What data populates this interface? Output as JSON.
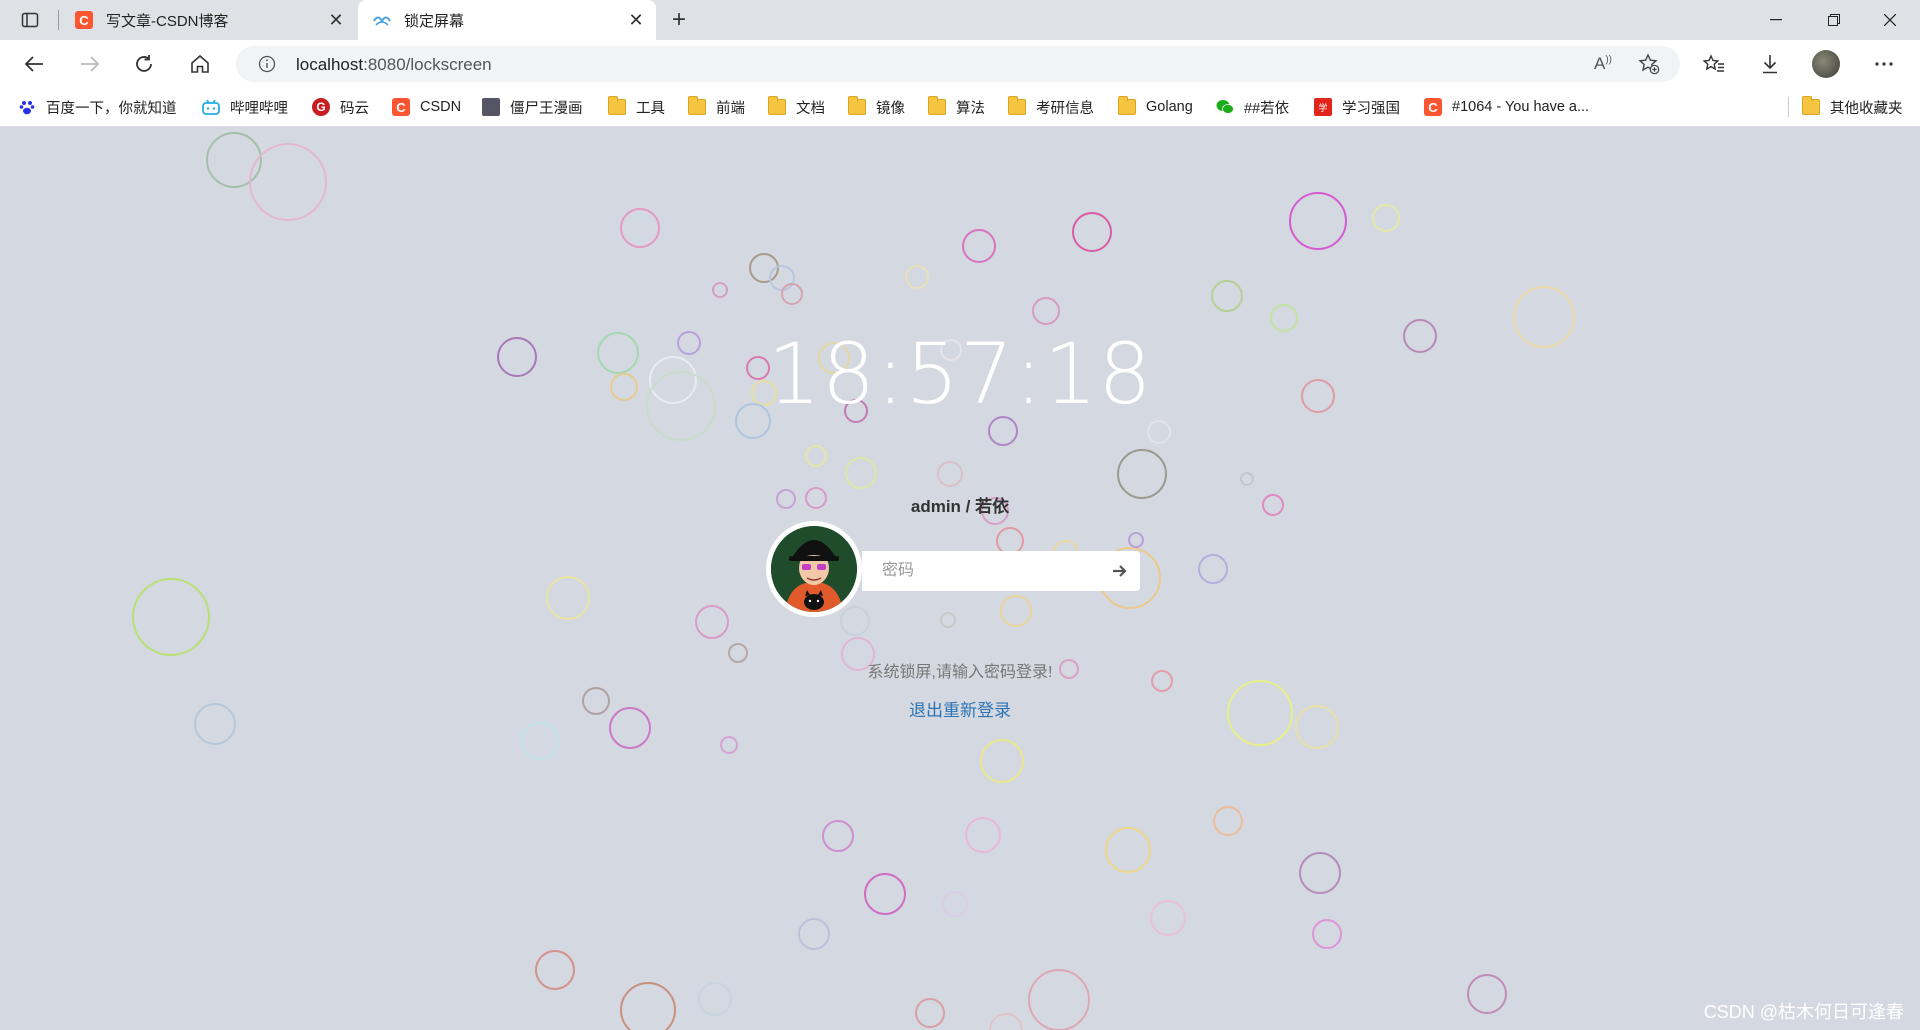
{
  "tabs": [
    {
      "title": "写文章-CSDN博客",
      "icon": "csdn-icon"
    },
    {
      "title": "锁定屏幕",
      "icon": "element-icon"
    }
  ],
  "address_bar": {
    "host": "localhost",
    "path": ":8080/lockscreen"
  },
  "bookmarks": [
    {
      "label": "百度一下，你就知道",
      "icon": "baidu-icon"
    },
    {
      "label": "哔哩哔哩",
      "icon": "bilibili-icon"
    },
    {
      "label": "码云",
      "icon": "gitee-icon"
    },
    {
      "label": "CSDN",
      "icon": "csdn-icon"
    },
    {
      "label": "僵尸王漫画",
      "icon": "manga-icon"
    },
    {
      "label": "工具",
      "icon": "folder-icon"
    },
    {
      "label": "前端",
      "icon": "folder-icon"
    },
    {
      "label": "文档",
      "icon": "folder-icon"
    },
    {
      "label": "镜像",
      "icon": "folder-icon"
    },
    {
      "label": "算法",
      "icon": "folder-icon"
    },
    {
      "label": "考研信息",
      "icon": "folder-icon"
    },
    {
      "label": "Golang",
      "icon": "folder-icon"
    },
    {
      "label": "##若依",
      "icon": "wechat-icon"
    },
    {
      "label": "学习强国",
      "icon": "xuexi-icon"
    },
    {
      "label": "#1064 - You have a...",
      "icon": "csdn-icon"
    }
  ],
  "other_bookmarks": "其他收藏夹",
  "lock": {
    "time": "18:57:18",
    "user": "admin / 若依",
    "password_placeholder": "密码",
    "hint": "系统锁屏,请输入密码登录!",
    "relogin": "退出重新登录"
  },
  "watermark": "CSDN @枯木何日可逢春",
  "colors": {
    "background": "#d4d8e0",
    "link": "#2e74b5",
    "csdn": "#fc5531"
  }
}
